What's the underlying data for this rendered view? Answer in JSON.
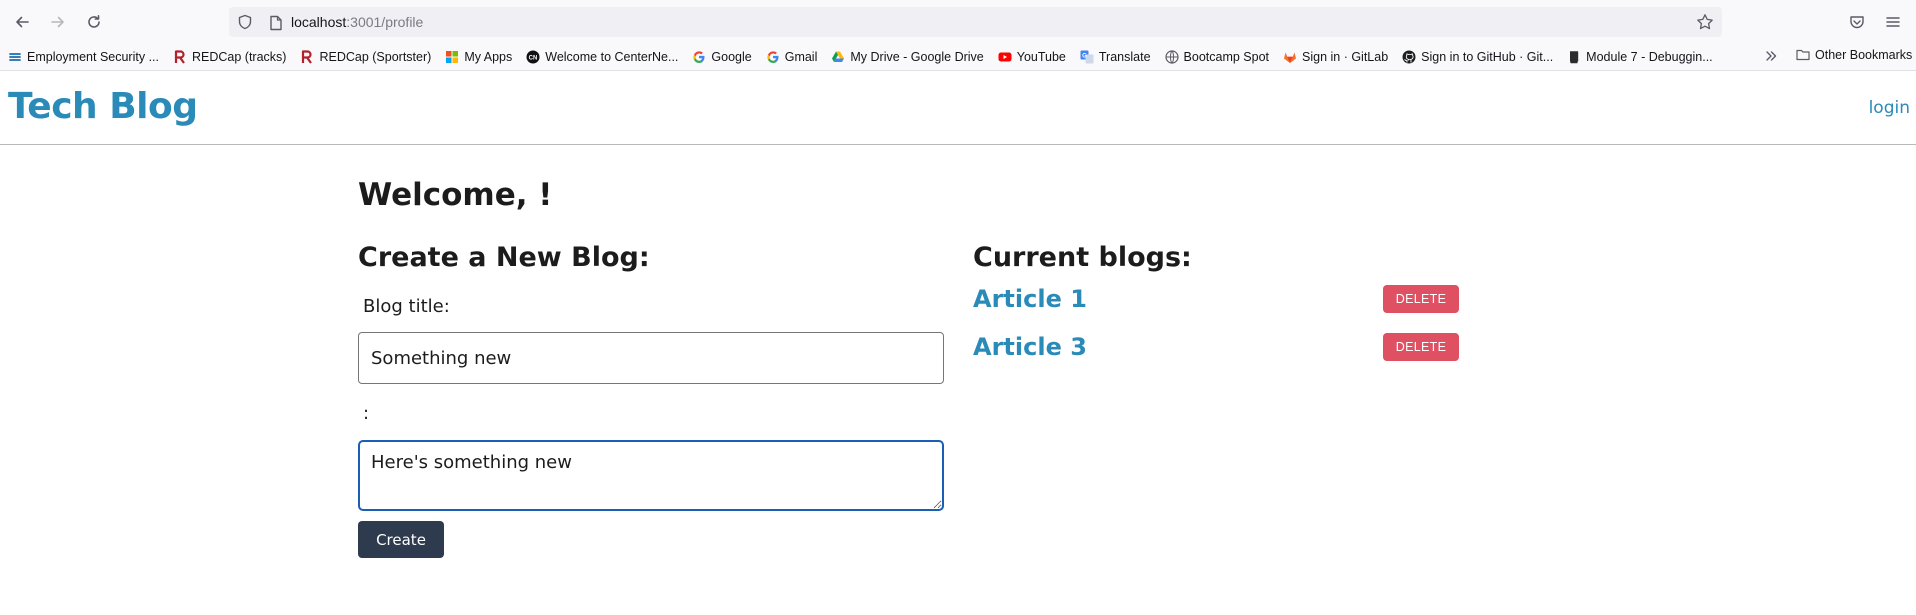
{
  "browser": {
    "url_host": "localhost",
    "url_path": ":3001/profile"
  },
  "bookmarks": [
    {
      "label": "Employment Security ...",
      "icon": "employment-security-icon"
    },
    {
      "label": "REDCap (tracks)",
      "icon": "redcap-icon"
    },
    {
      "label": "REDCap (Sportster)",
      "icon": "redcap-icon"
    },
    {
      "label": "My Apps",
      "icon": "microsoft-apps-icon"
    },
    {
      "label": "Welcome to CenterNe...",
      "icon": "centernet-icon"
    },
    {
      "label": "Google",
      "icon": "google-icon"
    },
    {
      "label": "Gmail",
      "icon": "google-icon"
    },
    {
      "label": "My Drive - Google Drive",
      "icon": "google-drive-icon"
    },
    {
      "label": "YouTube",
      "icon": "youtube-icon"
    },
    {
      "label": "Translate",
      "icon": "translate-icon"
    },
    {
      "label": "Bootcamp Spot",
      "icon": "globe-icon"
    },
    {
      "label": "Sign in · GitLab",
      "icon": "gitlab-icon"
    },
    {
      "label": "Sign in to GitHub · Git...",
      "icon": "github-icon"
    },
    {
      "label": "Module 7 - Debuggin...",
      "icon": "book-icon"
    }
  ],
  "other_bookmarks_label": "Other Bookmarks",
  "site": {
    "title": "Tech Blog",
    "login_label": "login"
  },
  "profile": {
    "welcome": "Welcome, !",
    "create_heading": "Create a New Blog:",
    "title_label": "Blog title:",
    "title_value": "Something new",
    "body_label": ":",
    "body_value": "Here's something new",
    "create_button": "Create",
    "current_heading": "Current blogs:",
    "blogs": [
      {
        "title": "Article 1",
        "delete_label": "DELETE"
      },
      {
        "title": "Article 3",
        "delete_label": "DELETE"
      }
    ]
  }
}
